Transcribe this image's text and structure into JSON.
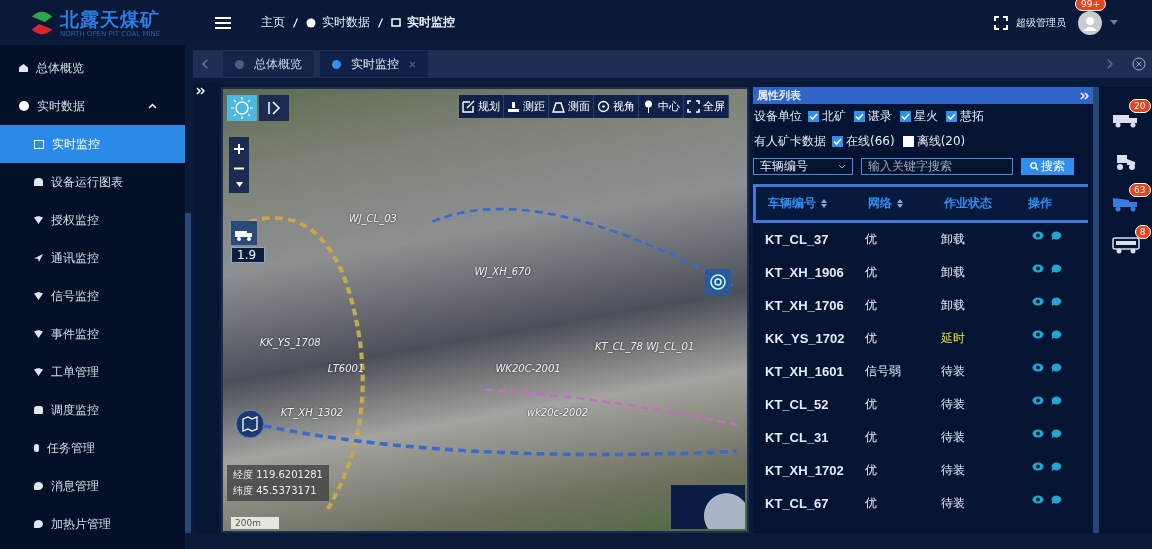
{
  "logo": {
    "title": "北露天煤矿",
    "subtitle": "NORTH OPEN PIT COAL MINE"
  },
  "breadcrumb": [
    "主页",
    "实时数据",
    "实时监控"
  ],
  "user": {
    "name": "超级管理员",
    "badge": "99+"
  },
  "sidebar": {
    "items": [
      {
        "label": "总体概览",
        "selected": false
      },
      {
        "label": "实时数据",
        "selected": false,
        "expanded": true,
        "children": [
          {
            "label": "实时监控",
            "selected": true
          },
          {
            "label": "设备运行图表",
            "selected": false
          },
          {
            "label": "授权监控",
            "selected": false
          },
          {
            "label": "通讯监控",
            "selected": false
          },
          {
            "label": "信号监控",
            "selected": false
          },
          {
            "label": "事件监控",
            "selected": false
          },
          {
            "label": "工单管理",
            "selected": false
          },
          {
            "label": "调度监控",
            "selected": false
          },
          {
            "label": "任务管理",
            "selected": false
          },
          {
            "label": "消息管理",
            "selected": false
          },
          {
            "label": "加热片管理",
            "selected": false
          }
        ]
      }
    ]
  },
  "tabs": [
    {
      "label": "总体概览",
      "selected": false
    },
    {
      "label": "实时监控",
      "selected": true
    }
  ],
  "map": {
    "tools": [
      "规划",
      "测距",
      "测面",
      "视角",
      "中心",
      "全屏"
    ],
    "zoom_value": "1.9",
    "longitude": "经度 119.6201281",
    "latitude": "纬度 45.5373171",
    "scale": "200m",
    "labels": [
      "WJ_CL_03",
      "WJ_XH_670",
      "KK_YS_1708",
      "LT6001",
      "WK20C-2001",
      "KT_CL_78  WJ_CL_01",
      "KT_XH_1302",
      "wk20c-2002"
    ]
  },
  "panel": {
    "title": "属性列表",
    "units_label": "设备单位",
    "units": [
      {
        "label": "北矿",
        "checked": true
      },
      {
        "label": "谌录",
        "checked": true
      },
      {
        "label": "星火",
        "checked": true
      },
      {
        "label": "慧拓",
        "checked": true
      }
    ],
    "trucks_label": "有人矿卡数据",
    "trucks": [
      {
        "label": "在线(66)",
        "checked": true
      },
      {
        "label": "离线(20)",
        "checked": false
      }
    ],
    "search_select": "车辆编号",
    "search_placeholder": "输入关键字搜索",
    "search_button": "搜索",
    "table": {
      "columns": [
        {
          "label": "车辆编号",
          "sortable": true
        },
        {
          "label": "网络",
          "sortable": true
        },
        {
          "label": "作业状态",
          "sortable": false
        },
        {
          "label": "操作",
          "sortable": false
        }
      ],
      "rows": [
        {
          "id": "KT_CL_37",
          "network": "优",
          "status": "卸载",
          "delayed": false
        },
        {
          "id": "KT_XH_1906",
          "network": "优",
          "status": "卸载",
          "delayed": false
        },
        {
          "id": "KT_XH_1706",
          "network": "优",
          "status": "卸载",
          "delayed": false
        },
        {
          "id": "KK_YS_1702",
          "network": "优",
          "status": "延时",
          "delayed": true
        },
        {
          "id": "KT_XH_1601",
          "network": "信号弱",
          "status": "待装",
          "delayed": false
        },
        {
          "id": "KT_CL_52",
          "network": "优",
          "status": "待装",
          "delayed": false
        },
        {
          "id": "KT_CL_31",
          "network": "优",
          "status": "待装",
          "delayed": false
        },
        {
          "id": "KT_XH_1702",
          "network": "优",
          "status": "待装",
          "delayed": false
        },
        {
          "id": "KT_CL_67",
          "network": "优",
          "status": "待装",
          "delayed": false
        }
      ]
    }
  },
  "vehicle_filters": [
    {
      "badge": "20",
      "selected": false
    },
    {
      "selected": false
    },
    {
      "badge": "63",
      "selected": true
    },
    {
      "badge": "8",
      "selected": false
    }
  ]
}
